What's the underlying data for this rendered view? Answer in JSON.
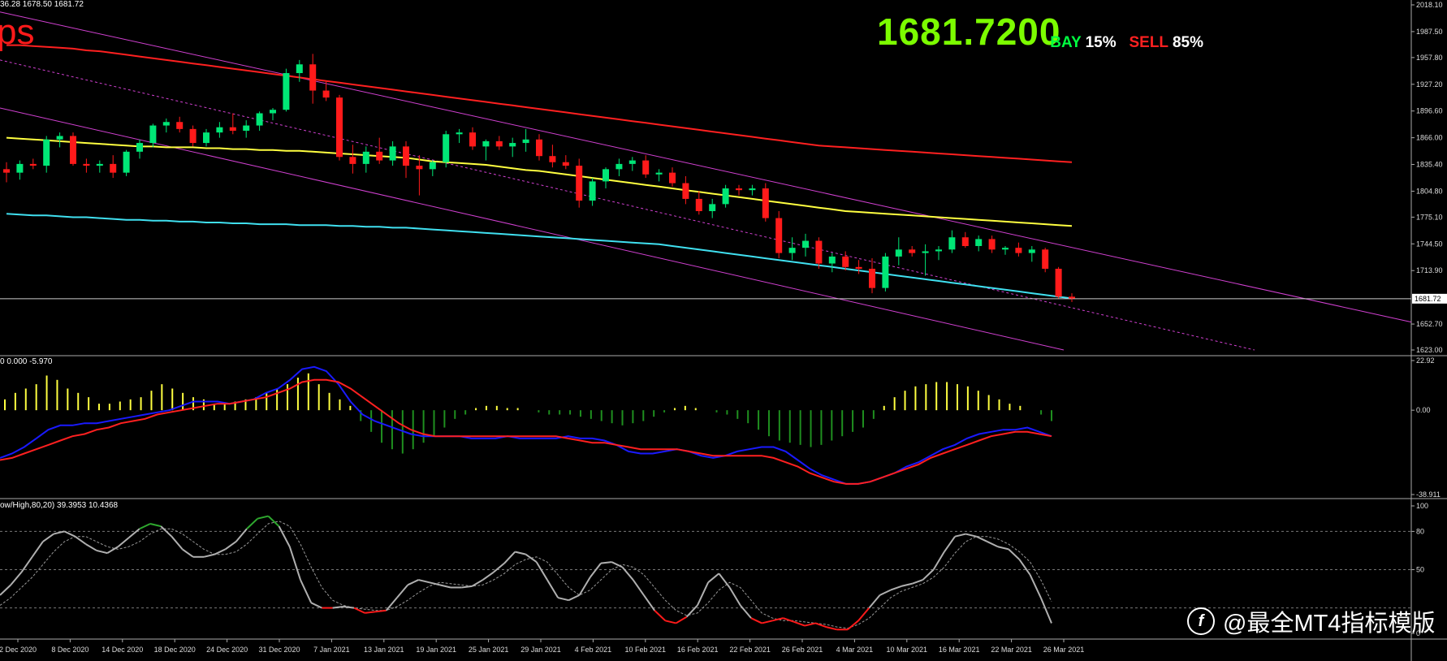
{
  "header": {
    "ohlc_text": "36.28 1678.50 1681.72",
    "corner_label": "ps",
    "big_price": "1681.7200",
    "bay_label": "BAY",
    "bay_pct": "15%",
    "sell_label": "SELL",
    "sell_pct": "85%"
  },
  "indicator1": {
    "header": "0 0.000 -5.970"
  },
  "indicator2": {
    "header": "ow/High,80,20) 39.3953 10.4368"
  },
  "watermark": {
    "text": "@最全MT4指标模版",
    "logo_glyph": "f"
  },
  "colors": {
    "bull": "#00e676",
    "bear": "#ff1a1a",
    "ma_red": "#ff2020",
    "ma_yellow": "#ffff40",
    "ma_cyan": "#40e0f0",
    "channel": "#d040d0",
    "macd_pos": "#ffff40",
    "macd_neg": "#1f8f1f",
    "macd_signal": "#ff2020",
    "macd_main": "#1a1aff",
    "stoch_main": "#b0b0b0",
    "stoch_ob": "#2ea82e",
    "stoch_os": "#ff1a1a"
  },
  "chart_data": [
    {
      "type": "candlestick",
      "title": "",
      "ylim": [
        1623.0,
        2018.1
      ],
      "last_price": "1681.72",
      "y_ticks": [
        "2018.10",
        "1987.50",
        "1957.80",
        "1927.20",
        "1896.60",
        "1866.00",
        "1835.40",
        "1804.80",
        "1775.10",
        "1744.50",
        "1713.90",
        "1652.70",
        "1623.00"
      ],
      "x_ticks": [
        "2 Dec 2020",
        "8 Dec 2020",
        "14 Dec 2020",
        "18 Dec 2020",
        "24 Dec 2020",
        "31 Dec 2020",
        "7 Jan 2021",
        "13 Jan 2021",
        "19 Jan 2021",
        "25 Jan 2021",
        "29 Jan 2021",
        "4 Feb 2021",
        "10 Feb 2021",
        "16 Feb 2021",
        "22 Feb 2021",
        "26 Feb 2021",
        "4 Mar 2021",
        "10 Mar 2021",
        "16 Mar 2021",
        "22 Mar 2021",
        "26 Mar 2021"
      ],
      "candles": [
        [
          1830,
          1838,
          1815,
          1826
        ],
        [
          1826,
          1840,
          1818,
          1836
        ],
        [
          1836,
          1842,
          1830,
          1834
        ],
        [
          1834,
          1868,
          1826,
          1864
        ],
        [
          1864,
          1872,
          1855,
          1868
        ],
        [
          1868,
          1872,
          1834,
          1836
        ],
        [
          1836,
          1842,
          1826,
          1834
        ],
        [
          1834,
          1840,
          1826,
          1836
        ],
        [
          1836,
          1846,
          1820,
          1826
        ],
        [
          1826,
          1852,
          1822,
          1850
        ],
        [
          1850,
          1864,
          1842,
          1860
        ],
        [
          1860,
          1882,
          1855,
          1880
        ],
        [
          1880,
          1888,
          1872,
          1884
        ],
        [
          1884,
          1890,
          1872,
          1876
        ],
        [
          1876,
          1880,
          1856,
          1860
        ],
        [
          1860,
          1876,
          1856,
          1872
        ],
        [
          1872,
          1884,
          1866,
          1878
        ],
        [
          1878,
          1894,
          1870,
          1874
        ],
        [
          1874,
          1886,
          1866,
          1880
        ],
        [
          1880,
          1896,
          1874,
          1894
        ],
        [
          1894,
          1900,
          1886,
          1898
        ],
        [
          1898,
          1945,
          1896,
          1940
        ],
        [
          1940,
          1955,
          1930,
          1950
        ],
        [
          1950,
          1962,
          1905,
          1920
        ],
        [
          1920,
          1930,
          1908,
          1912
        ],
        [
          1912,
          1915,
          1840,
          1844
        ],
        [
          1844,
          1858,
          1825,
          1836
        ],
        [
          1836,
          1856,
          1826,
          1850
        ],
        [
          1850,
          1866,
          1836,
          1840
        ],
        [
          1840,
          1862,
          1834,
          1856
        ],
        [
          1856,
          1862,
          1820,
          1834
        ],
        [
          1834,
          1846,
          1800,
          1830
        ],
        [
          1830,
          1840,
          1822,
          1838
        ],
        [
          1838,
          1874,
          1832,
          1870
        ],
        [
          1870,
          1876,
          1860,
          1872
        ],
        [
          1872,
          1878,
          1852,
          1856
        ],
        [
          1856,
          1864,
          1840,
          1862
        ],
        [
          1862,
          1868,
          1852,
          1856
        ],
        [
          1856,
          1866,
          1844,
          1860
        ],
        [
          1860,
          1876,
          1850,
          1864
        ],
        [
          1864,
          1870,
          1840,
          1845
        ],
        [
          1845,
          1858,
          1832,
          1838
        ],
        [
          1838,
          1846,
          1830,
          1834
        ],
        [
          1834,
          1842,
          1786,
          1794
        ],
        [
          1794,
          1820,
          1788,
          1816
        ],
        [
          1816,
          1832,
          1808,
          1830
        ],
        [
          1830,
          1842,
          1822,
          1836
        ],
        [
          1836,
          1844,
          1828,
          1840
        ],
        [
          1840,
          1846,
          1820,
          1824
        ],
        [
          1824,
          1830,
          1816,
          1826
        ],
        [
          1826,
          1832,
          1810,
          1814
        ],
        [
          1814,
          1822,
          1790,
          1796
        ],
        [
          1796,
          1805,
          1778,
          1782
        ],
        [
          1782,
          1796,
          1774,
          1790
        ],
        [
          1790,
          1812,
          1786,
          1808
        ],
        [
          1808,
          1812,
          1800,
          1806
        ],
        [
          1806,
          1812,
          1800,
          1808
        ],
        [
          1808,
          1814,
          1770,
          1774
        ],
        [
          1774,
          1782,
          1728,
          1734
        ],
        [
          1734,
          1752,
          1726,
          1740
        ],
        [
          1740,
          1756,
          1730,
          1748
        ],
        [
          1748,
          1752,
          1716,
          1722
        ],
        [
          1722,
          1734,
          1712,
          1730
        ],
        [
          1730,
          1736,
          1714,
          1718
        ],
        [
          1718,
          1726,
          1710,
          1716
        ],
        [
          1716,
          1728,
          1688,
          1694
        ],
        [
          1694,
          1734,
          1690,
          1730
        ],
        [
          1730,
          1752,
          1720,
          1738
        ],
        [
          1738,
          1742,
          1730,
          1734
        ],
        [
          1734,
          1744,
          1708,
          1736
        ],
        [
          1736,
          1742,
          1726,
          1738
        ],
        [
          1738,
          1760,
          1734,
          1752
        ],
        [
          1752,
          1758,
          1740,
          1742
        ],
        [
          1742,
          1754,
          1736,
          1750
        ],
        [
          1750,
          1754,
          1734,
          1738
        ],
        [
          1738,
          1742,
          1732,
          1740
        ],
        [
          1740,
          1746,
          1730,
          1734
        ],
        [
          1734,
          1742,
          1724,
          1738
        ],
        [
          1738,
          1740,
          1712,
          1716
        ],
        [
          1716,
          1718,
          1682,
          1684
        ],
        [
          1684,
          1688,
          1678,
          1682
        ]
      ],
      "ma_red": [
        1972,
        1972,
        1971,
        1970,
        1969,
        1968,
        1966,
        1965,
        1963,
        1961,
        1959,
        1957,
        1955,
        1953,
        1951,
        1949,
        1947,
        1945,
        1943,
        1941,
        1939,
        1937,
        1935,
        1933,
        1931,
        1929,
        1927,
        1925,
        1923,
        1921,
        1919,
        1917,
        1915,
        1913,
        1911,
        1909,
        1907,
        1905,
        1903,
        1901,
        1899,
        1897,
        1895,
        1893,
        1891,
        1889,
        1887,
        1885,
        1883,
        1881,
        1879,
        1877,
        1875,
        1873,
        1871,
        1869,
        1867,
        1865,
        1863,
        1861,
        1859,
        1857,
        1856,
        1855,
        1854,
        1853,
        1852,
        1851,
        1850,
        1849,
        1848,
        1847,
        1846,
        1845,
        1844,
        1843,
        1842,
        1841,
        1840,
        1839,
        1838
      ],
      "ma_yellow": [
        1866,
        1865,
        1864,
        1863,
        1862,
        1861,
        1860,
        1859,
        1858,
        1857,
        1856,
        1856,
        1855,
        1855,
        1855,
        1854,
        1854,
        1853,
        1853,
        1852,
        1852,
        1851,
        1851,
        1850,
        1849,
        1848,
        1847,
        1846,
        1845,
        1844,
        1843,
        1841,
        1839,
        1838,
        1837,
        1836,
        1835,
        1833,
        1831,
        1829,
        1828,
        1826,
        1824,
        1822,
        1820,
        1818,
        1816,
        1814,
        1812,
        1810,
        1808,
        1806,
        1804,
        1802,
        1800,
        1798,
        1796,
        1794,
        1792,
        1790,
        1788,
        1786,
        1784,
        1782,
        1781,
        1780,
        1779,
        1778,
        1777,
        1776,
        1775,
        1774,
        1773,
        1772,
        1771,
        1770,
        1769,
        1768,
        1767,
        1766,
        1765
      ],
      "ma_cyan": [
        1779,
        1778,
        1777,
        1777,
        1776,
        1775,
        1775,
        1774,
        1773,
        1772,
        1772,
        1771,
        1771,
        1770,
        1770,
        1769,
        1769,
        1768,
        1768,
        1767,
        1767,
        1767,
        1766,
        1766,
        1766,
        1765,
        1765,
        1764,
        1764,
        1763,
        1763,
        1762,
        1761,
        1760,
        1759,
        1758,
        1757,
        1756,
        1755,
        1754,
        1753,
        1752,
        1751,
        1750,
        1749,
        1748,
        1747,
        1746,
        1745,
        1744,
        1742,
        1740,
        1738,
        1736,
        1734,
        1732,
        1730,
        1728,
        1726,
        1724,
        1722,
        1720,
        1718,
        1716,
        1714,
        1712,
        1710,
        1708,
        1706,
        1704,
        1702,
        1700,
        1698,
        1696,
        1694,
        1692,
        1690,
        1688,
        1686,
        1684,
        1682
      ]
    },
    {
      "type": "bar",
      "title": "",
      "ylim": [
        -38.911,
        22.92
      ],
      "y_ticks": [
        "22.92",
        "0.00",
        "-38.911"
      ],
      "histogram": [
        5,
        8,
        10,
        12,
        16,
        14,
        10,
        8,
        6,
        3,
        3,
        4,
        5,
        6,
        9,
        12,
        10,
        8,
        6,
        5,
        3,
        3,
        4,
        5,
        6,
        8,
        10,
        12,
        15,
        17,
        12,
        8,
        5,
        2,
        -5,
        -10,
        -15,
        -18,
        -20,
        -18,
        -15,
        -12,
        -8,
        -4,
        -2,
        1,
        2,
        2,
        1,
        1,
        0,
        -1,
        -2,
        -2,
        -2,
        -3,
        -4,
        -5,
        -6,
        -7,
        -6,
        -5,
        -3,
        -1,
        1,
        2,
        1,
        0,
        -1,
        -2,
        -4,
        -6,
        -9,
        -12,
        -14,
        -15,
        -16,
        -17,
        -16,
        -14,
        -12,
        -10,
        -8,
        -4,
        2,
        6,
        9,
        11,
        12,
        13,
        13,
        12,
        11,
        9,
        7,
        5,
        3,
        2,
        0,
        -2,
        -5
      ],
      "main": [
        -22,
        -20,
        -17,
        -13,
        -9,
        -7,
        -7,
        -6,
        -6,
        -5,
        -4,
        -3,
        -2,
        -1,
        0,
        2,
        4,
        4,
        4,
        3,
        4,
        5,
        8,
        10,
        14,
        19,
        20,
        18,
        12,
        4,
        -2,
        -5,
        -7,
        -9,
        -11,
        -12,
        -12,
        -12,
        -12,
        -13,
        -13,
        -13,
        -12,
        -13,
        -13,
        -13,
        -13,
        -12,
        -13,
        -13,
        -14,
        -16,
        -19,
        -20,
        -20,
        -19,
        -18,
        -19,
        -21,
        -22,
        -21,
        -19,
        -18,
        -17,
        -17,
        -19,
        -23,
        -27,
        -30,
        -32,
        -34,
        -34,
        -33,
        -31,
        -29,
        -26,
        -24,
        -21,
        -18,
        -16,
        -13,
        -11,
        -10,
        -9,
        -9,
        -8,
        -10,
        -12
      ],
      "signal": [
        -23,
        -22,
        -20,
        -18,
        -16,
        -14,
        -12,
        -11,
        -9,
        -8,
        -6,
        -5,
        -4,
        -2,
        -1,
        0,
        1,
        2,
        3,
        3,
        4,
        5,
        6,
        8,
        10,
        13,
        14,
        14,
        13,
        10,
        6,
        2,
        -2,
        -6,
        -9,
        -11,
        -12,
        -12,
        -12,
        -12,
        -12,
        -12,
        -12,
        -12,
        -12,
        -12,
        -12,
        -13,
        -14,
        -15,
        -15,
        -16,
        -17,
        -18,
        -18,
        -18,
        -18,
        -19,
        -20,
        -21,
        -21,
        -21,
        -21,
        -21,
        -22,
        -24,
        -26,
        -29,
        -31,
        -33,
        -34,
        -34,
        -33,
        -31,
        -29,
        -27,
        -25,
        -22,
        -20,
        -18,
        -16,
        -14,
        -12,
        -11,
        -10,
        -10,
        -11,
        -12
      ]
    },
    {
      "type": "line",
      "title": "",
      "ylim": [
        0,
        100
      ],
      "y_ticks": [
        "100",
        "80",
        "50",
        "0"
      ],
      "levels": [
        80,
        50,
        20
      ],
      "main": [
        30,
        38,
        48,
        60,
        72,
        78,
        80,
        76,
        70,
        65,
        63,
        68,
        75,
        82,
        86,
        84,
        76,
        66,
        60,
        60,
        62,
        66,
        72,
        82,
        90,
        92,
        84,
        68,
        42,
        24,
        20,
        20,
        21,
        20,
        16,
        17,
        18,
        28,
        38,
        42,
        40,
        38,
        36,
        36,
        37,
        42,
        48,
        55,
        64,
        62,
        56,
        42,
        28,
        26,
        30,
        44,
        55,
        56,
        52,
        42,
        30,
        18,
        10,
        8,
        13,
        22,
        40,
        47,
        36,
        22,
        12,
        8,
        10,
        12,
        9,
        6,
        8,
        5,
        3,
        3,
        10,
        20,
        30,
        34,
        37,
        39,
        42,
        50,
        64,
        76,
        78,
        76,
        72,
        68,
        66,
        58,
        46,
        28,
        8
      ],
      "signal": [
        22,
        28,
        36,
        44,
        54,
        64,
        72,
        76,
        76,
        72,
        68,
        66,
        68,
        72,
        78,
        82,
        82,
        78,
        72,
        66,
        62,
        62,
        64,
        70,
        78,
        86,
        88,
        84,
        70,
        52,
        36,
        26,
        22,
        20,
        19,
        18,
        18,
        21,
        26,
        32,
        37,
        40,
        39,
        38,
        37,
        38,
        42,
        47,
        54,
        58,
        60,
        56,
        46,
        36,
        30,
        34,
        42,
        50,
        54,
        52,
        46,
        36,
        26,
        18,
        14,
        16,
        24,
        34,
        40,
        36,
        26,
        16,
        12,
        10,
        10,
        9,
        8,
        7,
        5,
        4,
        7,
        12,
        20,
        28,
        33,
        36,
        39,
        44,
        52,
        63,
        72,
        76,
        76,
        74,
        70,
        64,
        56,
        42,
        25
      ],
      "ob_level": 80,
      "os_level": 20
    }
  ]
}
